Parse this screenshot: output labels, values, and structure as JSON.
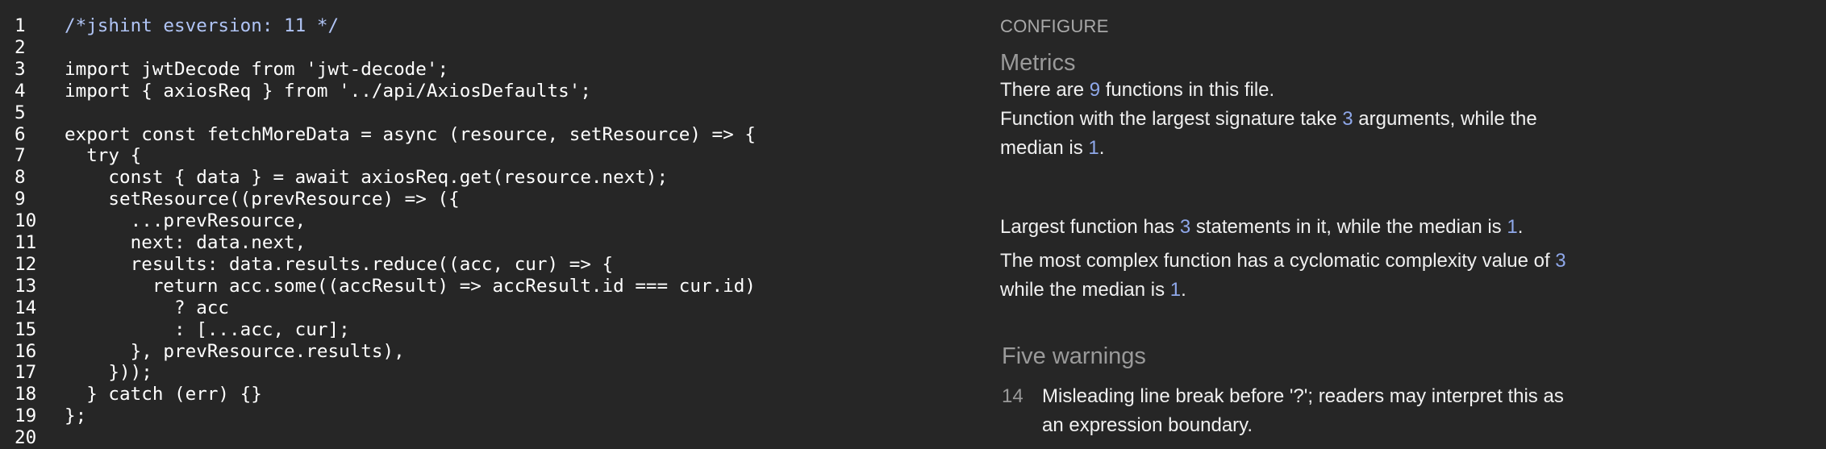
{
  "editor": {
    "lines": [
      {
        "n": "1",
        "text": "/*jshint esversion: 11 */",
        "color": "#b0c4f5"
      },
      {
        "n": "2",
        "text": ""
      },
      {
        "n": "3",
        "text": "import jwtDecode from 'jwt-decode';"
      },
      {
        "n": "4",
        "text": "import { axiosReq } from '../api/AxiosDefaults';"
      },
      {
        "n": "5",
        "text": ""
      },
      {
        "n": "6",
        "text": "export const fetchMoreData = async (resource, setResource) => {"
      },
      {
        "n": "7",
        "text": "  try {"
      },
      {
        "n": "8",
        "text": "    const { data } = await axiosReq.get(resource.next);"
      },
      {
        "n": "9",
        "text": "    setResource((prevResource) => ({"
      },
      {
        "n": "10",
        "text": "      ...prevResource,"
      },
      {
        "n": "11",
        "text": "      next: data.next,"
      },
      {
        "n": "12",
        "text": "      results: data.results.reduce((acc, cur) => {"
      },
      {
        "n": "13",
        "text": "        return acc.some((accResult) => accResult.id === cur.id)"
      },
      {
        "n": "14",
        "text": "          ? acc"
      },
      {
        "n": "15",
        "text": "          : [...acc, cur];"
      },
      {
        "n": "16",
        "text": "      }, prevResource.results),"
      },
      {
        "n": "17",
        "text": "    }));"
      },
      {
        "n": "18",
        "text": "  } catch (err) {}"
      },
      {
        "n": "19",
        "text": "};"
      },
      {
        "n": "20",
        "text": ""
      }
    ]
  },
  "panel": {
    "configure": "CONFIGURE",
    "metrics": {
      "title": "Metrics",
      "p1": {
        "a": "There are ",
        "n": "9",
        "b": " functions in this file."
      },
      "p2": {
        "a": "Function with the largest signature take ",
        "n": "3",
        "b": " arguments, while the median is ",
        "m": "1",
        "c": "."
      },
      "p3": {
        "a": "Largest function has ",
        "n": "3",
        "b": " statements in it, while the median is ",
        "m": "1",
        "c": "."
      },
      "p4": {
        "a": "The most complex function has a cyclomatic complexity value of ",
        "n": "3",
        "b": " while the median is ",
        "m": "1",
        "c": "."
      }
    },
    "warnings": {
      "title": "Five warnings",
      "items": [
        {
          "line": "14",
          "text": "Misleading line break before '?'; readers may interpret this as an expression boundary."
        }
      ]
    }
  }
}
